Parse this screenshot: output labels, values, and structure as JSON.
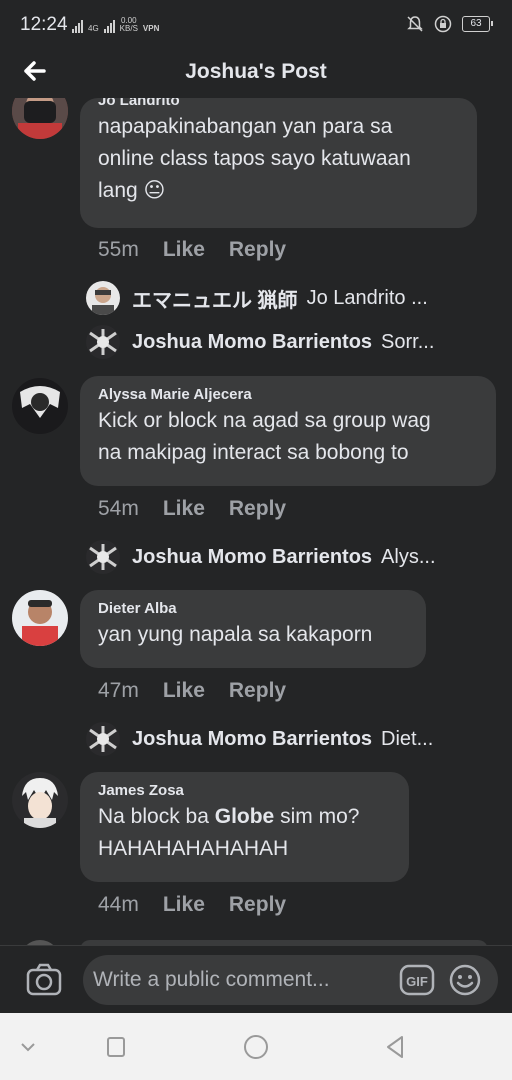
{
  "status_bar": {
    "time": "12:24",
    "network": "4G",
    "speed_value": "0.00",
    "speed_unit": "KB/S",
    "vpn": "VPN",
    "battery": "63"
  },
  "header": {
    "title": "Joshua's Post"
  },
  "comments": [
    {
      "name": "Jo Landrito",
      "lines": [
        "napapakinabangan yan para sa",
        "online class tapos sayo katuwaan",
        "lang 😐"
      ],
      "time": "55m",
      "like_label": "Like",
      "reply_label": "Reply",
      "replies": [
        {
          "name": "エマニュエル 猟師",
          "preview": "Jo Landrito ..."
        },
        {
          "name": "Joshua Momo Barrientos",
          "preview": "Sorr..."
        }
      ]
    },
    {
      "name": "Alyssa Marie Aljecera",
      "lines": [
        "Kick or block na agad sa group wag",
        "na makipag interact sa bobong to"
      ],
      "time": "54m",
      "like_label": "Like",
      "reply_label": "Reply",
      "replies": [
        {
          "name": "Joshua Momo Barrientos",
          "preview": "Alys..."
        }
      ]
    },
    {
      "name": "Dieter Alba",
      "lines": [
        "yan yung napala sa kakaporn"
      ],
      "time": "47m",
      "like_label": "Like",
      "reply_label": "Reply",
      "replies": [
        {
          "name": "Joshua Momo Barrientos",
          "preview": "Diet..."
        }
      ]
    },
    {
      "name": "James Zosa",
      "line1_pre": "Na block ba ",
      "line1_bold": "Globe",
      "line1_post": " sim mo?",
      "line2": "HAHAHAHAHAHAH",
      "time": "44m",
      "like_label": "Like",
      "reply_label": "Reply"
    }
  ],
  "composer": {
    "placeholder": "Write a public comment...",
    "gif_label": "GIF"
  },
  "icons": {
    "back": "arrow-left-icon",
    "camera": "camera-icon",
    "gif": "gif-icon",
    "emoji": "emoji-icon",
    "nav_back": "triangle-back-icon",
    "nav_home": "circle-home-icon",
    "nav_recents": "square-recents-icon",
    "nav_collapse": "chevron-down-icon"
  },
  "colors": {
    "background": "#242526",
    "bubble": "#3a3b3c",
    "text": "#e4e6eb",
    "muted": "#9ea1a6"
  }
}
